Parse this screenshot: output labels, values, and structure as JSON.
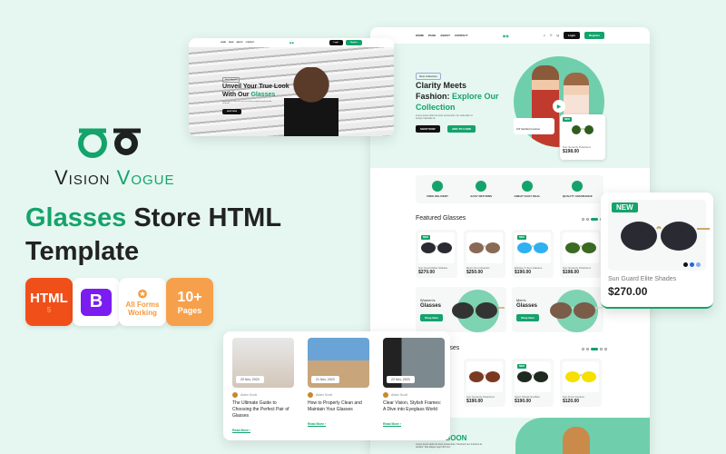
{
  "brand": {
    "name_part1": "Vision",
    "name_part2": "Vogue",
    "accent": "#14a36b"
  },
  "headline": {
    "highlight": "Glasses",
    "rest": "Store HTML",
    "line2": "Template"
  },
  "badges": [
    {
      "label": "HTML",
      "sub": "5"
    },
    {
      "label": "B"
    },
    {
      "label": "All Forms Working"
    },
    {
      "label": "10+",
      "sub": "Pages"
    }
  ],
  "small_window": {
    "nav": [
      "HOME",
      "PAGE",
      "ABOUT",
      "CONTACT"
    ],
    "login": "Login",
    "register": "Register",
    "tag": "New Collection",
    "title_line1": "Unveil Your True Look",
    "title_line2": "With Our",
    "title_highlight": "Glasses",
    "desc": "Lorem ipsum dolor sit amet consectetur adipiscing elit sed do eiusmod.",
    "cta": "SHOP NOW"
  },
  "main_window": {
    "nav": [
      "HOME",
      "PAGE",
      "ABOUT",
      "CONTACT"
    ],
    "login": "Login",
    "register": "Register",
    "hero": {
      "tag": "New Collection",
      "title1": "Clarity Meets",
      "title2": "Fashion:",
      "highlight": "Explore Our Collection",
      "desc": "Lorem ipsum dolor sit amet consectetur. Ac nulla diam id tempor vulputate id.",
      "shop": "SHOP NOW",
      "cart": "ADD TO CARD",
      "customers": "10K Satisfied Customer",
      "card_tag": "NEW",
      "card_name": "Sun Serenity Polarized",
      "card_price": "$198.00"
    },
    "features": [
      "FREE DELIVERY",
      "EASY RETURNS",
      "GREAT DAILY DEAL",
      "QUALITY ASSURANCE"
    ],
    "featured_title": "Featured Glasses",
    "featured": [
      {
        "name": "Sun Guard Elite Shades",
        "price": "$270.00",
        "tag": "NEW"
      },
      {
        "name": "Retro Sun Classics",
        "price": "$250.00"
      },
      {
        "name": "Eclipse X Sun Glasses",
        "price": "$190.00",
        "tag": "NEW"
      },
      {
        "name": "Sun Serenity Polarized",
        "price": "$198.00"
      }
    ],
    "promos": [
      {
        "line1": "Women's",
        "line2": "Glasses",
        "btn": "Shop Now"
      },
      {
        "line1": "Men's",
        "line2": "Glasses",
        "btn": "Shop Now"
      }
    ],
    "second_title": "asses",
    "second": [
      {
        "name": "Sun Serenity Polarized",
        "price": "$190.00"
      },
      {
        "name": "Sport Shield Sunfiles",
        "price": "$190.00",
        "tag": "NEW"
      },
      {
        "name": "Sun Pure Couture",
        "price": "$120.00"
      }
    ],
    "coming": {
      "title1": "COMING",
      "title2": "SOON",
      "desc": "Lorem ipsum dolor sit amet consectetur. Hendrerit nec tincidunt ac porttitor. Sed aliquet eget nibh orci."
    }
  },
  "popup": {
    "tag": "NEW",
    "name": "Sun Guard Elite Shades",
    "price": "$270.00",
    "swatches": [
      "#111111",
      "#2266dd",
      "#88aaee"
    ]
  },
  "blogs": [
    {
      "date": "20 Nov, 2023",
      "author": "Aiden Scott",
      "title": "The Ultimate Guide to Choosing the Perfect Pair of Glasses",
      "more": "Read More"
    },
    {
      "date": "21 Nov, 2023",
      "author": "Aiden Scott",
      "title": "How to Properly Clean and Maintain Your Glasses",
      "more": "Read More"
    },
    {
      "date": "22 Nov, 2023",
      "author": "Aiden Scott",
      "title": "Clear Vision, Stylish Frames: A Dive into Eyeglass World",
      "more": "Read More"
    }
  ]
}
